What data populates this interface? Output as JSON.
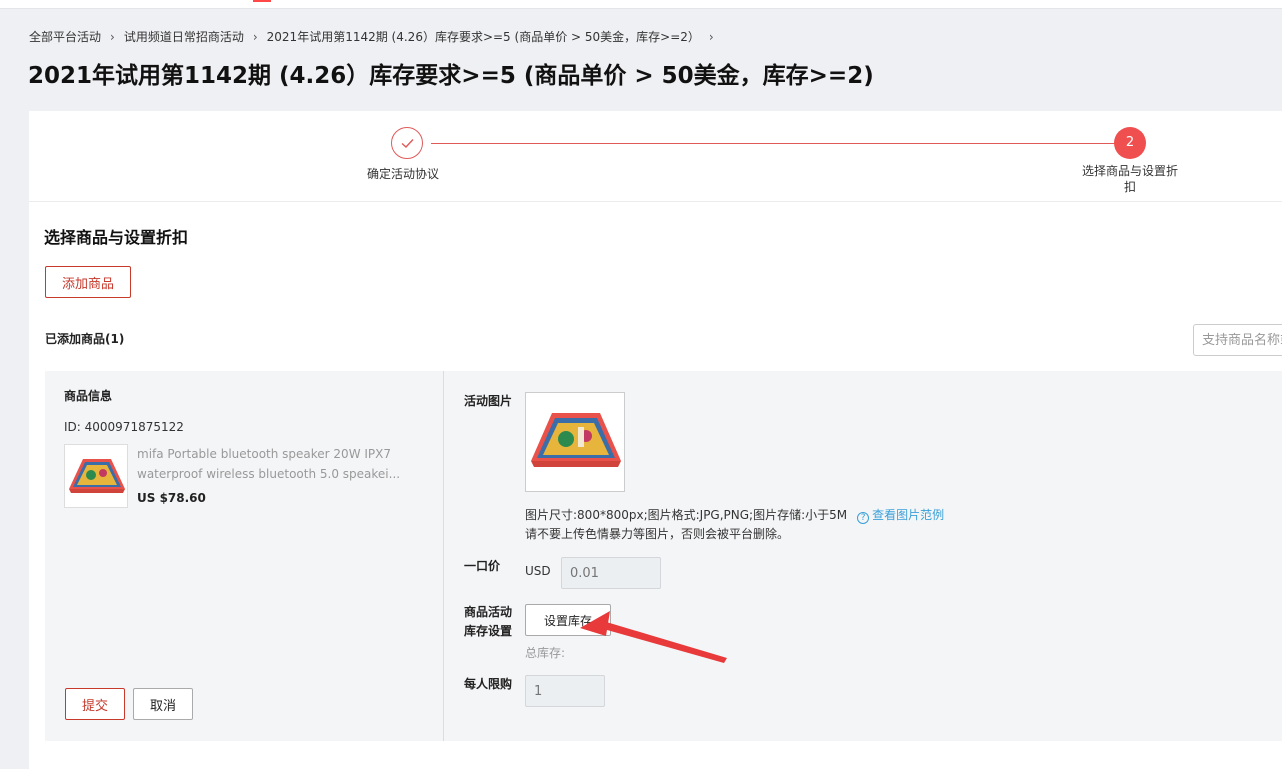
{
  "breadcrumb": {
    "items": [
      "全部平台活动",
      "试用频道日常招商活动",
      "2021年试用第1142期 (4.26）库存要求>=5 (商品单价 > 50美金，库存>=2）"
    ],
    "separator": "›"
  },
  "page_title": "2021年试用第1142期 (4.26）库存要求>=5 (商品单价 > 50美金，库存>=2)",
  "steps": [
    {
      "label": "确定活动协议",
      "status": "done"
    },
    {
      "number": "2",
      "label": "选择商品与设置折扣",
      "status": "active"
    }
  ],
  "section_title": "选择商品与设置折扣",
  "add_button": "添加商品",
  "added_title": "已添加商品(1)",
  "search": {
    "placeholder": "支持商品名称或ID"
  },
  "product": {
    "info_title": "商品信息",
    "id": "ID: 4000971875122",
    "name": "mifa Portable bluetooth speaker 20W IPX7 waterproof  wireless bluetooth 5.0 speakei...",
    "price": "US $78.60"
  },
  "form": {
    "image_label": "活动图片",
    "image_hint": "图片尺寸:800*800px;图片格式:JPG,PNG;图片存储:小于5M",
    "image_link": "查看图片范例",
    "image_warning": "请不要上传色情暴力等图片，否则会被平台删除。",
    "price_label": "一口价",
    "currency": "USD",
    "price_value": "0.01",
    "stock_label": "商品活动库存设置",
    "stock_button": "设置库存",
    "total_stock": "总库存:",
    "limit_label": "每人限购",
    "limit_value": "1"
  },
  "submit_button": "提交",
  "cancel_button": "取消",
  "colors": {
    "accent": "#c6392b",
    "step_active": "#f04f4f",
    "link": "#3aa0d8",
    "arrow": "#e83a3a"
  },
  "icons": [
    "check-icon",
    "question-icon",
    "chevron-right-icon",
    "annotation-arrow"
  ]
}
